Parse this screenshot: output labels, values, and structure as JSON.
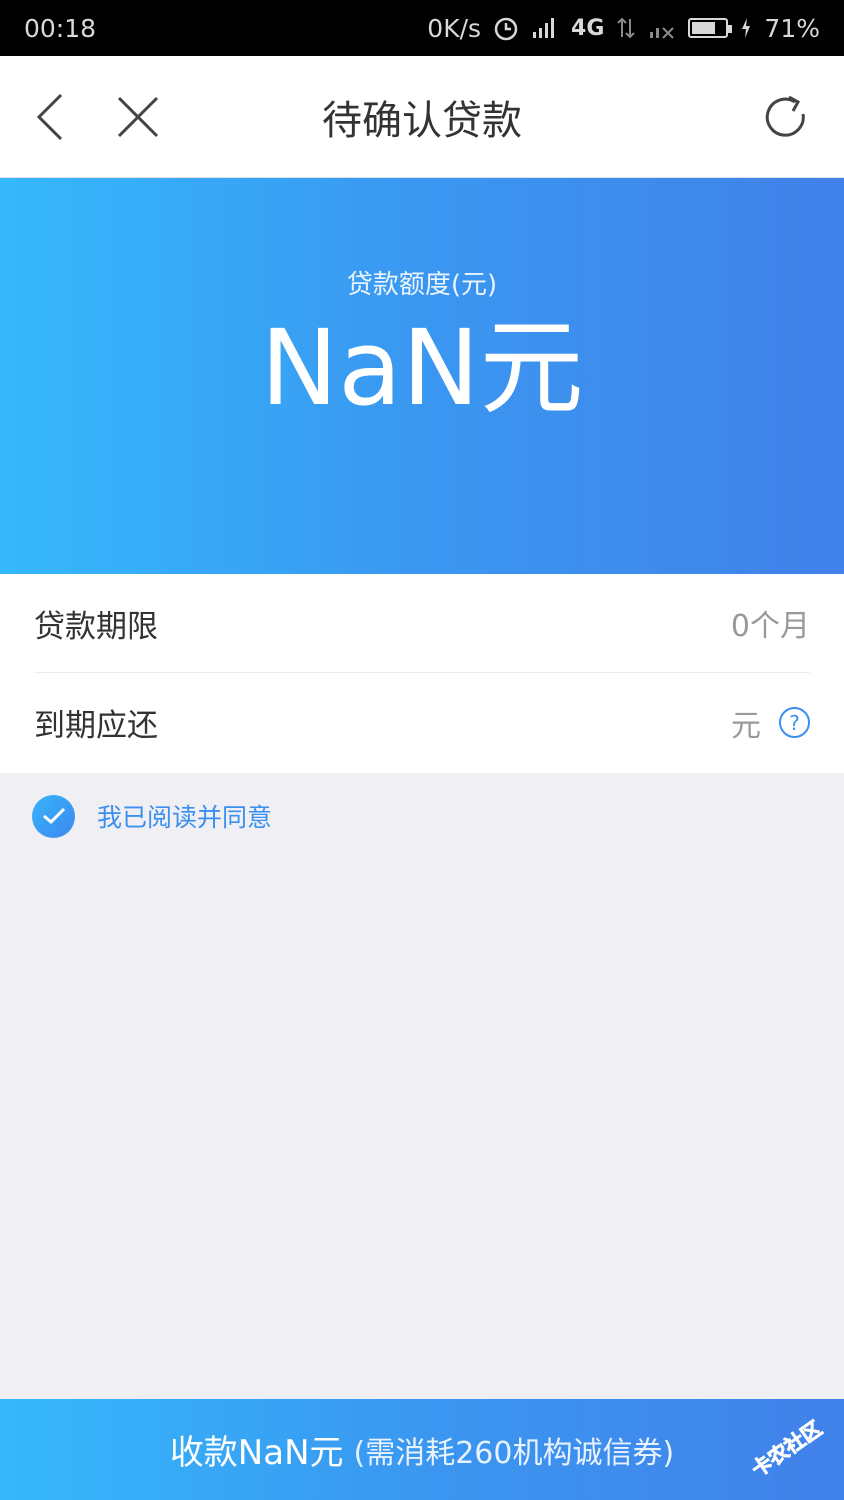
{
  "status_bar": {
    "time": "00:18",
    "speed": "0K/s",
    "network": "4G",
    "battery_percent": "71%",
    "battery_level": 0.71
  },
  "nav": {
    "title": "待确认贷款"
  },
  "hero": {
    "label": "贷款额度(元)",
    "amount": "NaN元"
  },
  "info": {
    "term_label": "贷款期限",
    "term_value": "0个月",
    "due_label": "到期应还",
    "due_value": "元"
  },
  "agreement": {
    "text": "我已阅读并同意",
    "checked": true
  },
  "bottom_button": {
    "main": "收款NaN元",
    "sub": "(需消耗260机构诚信券)"
  },
  "watermark": {
    "text": "卡农社区"
  },
  "colors": {
    "accent": "#3b8ff0",
    "gradient_start": "#35b8fb",
    "gradient_end": "#4181ea"
  }
}
